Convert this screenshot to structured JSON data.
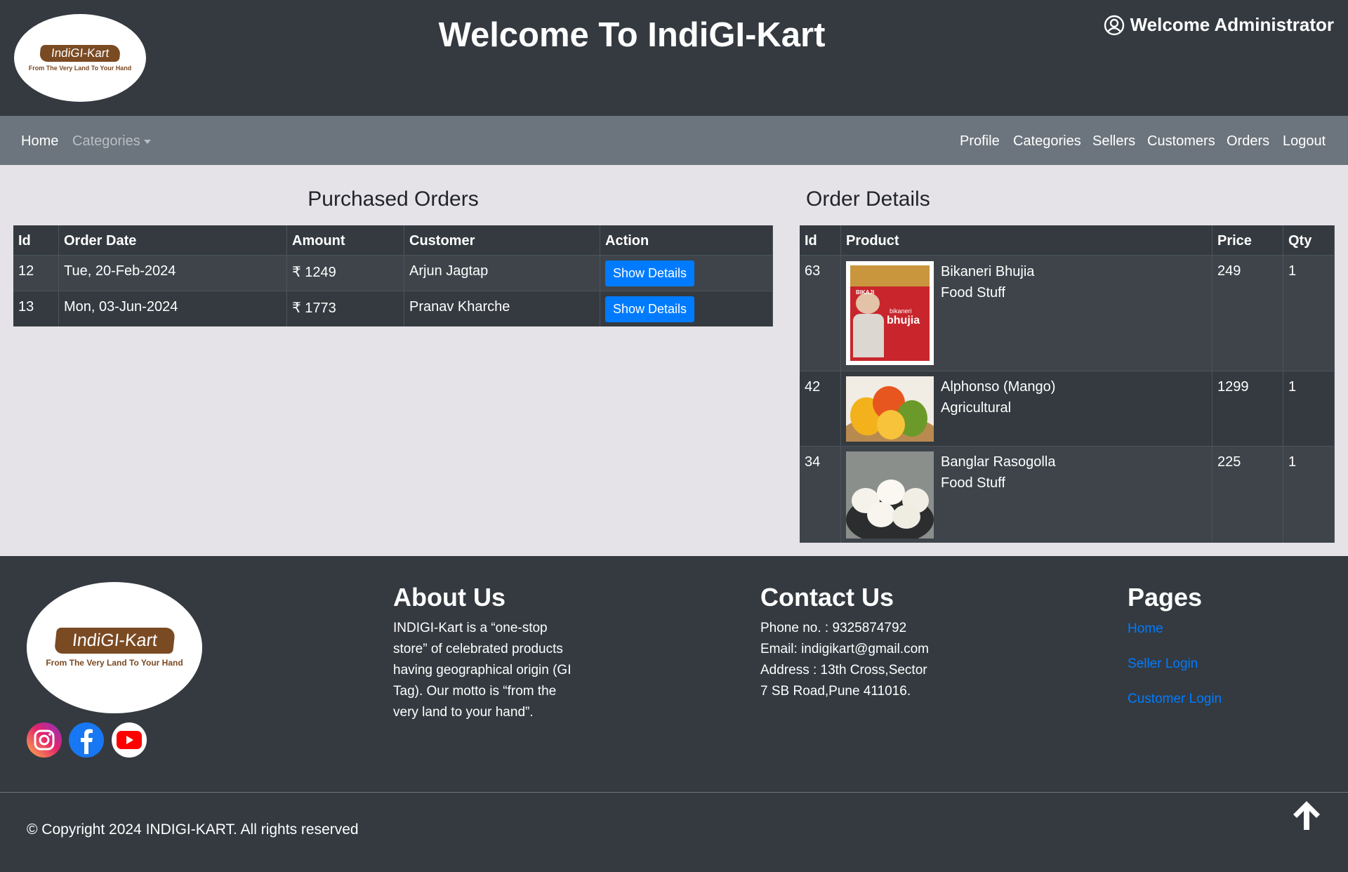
{
  "header": {
    "logo_text": "IndiGI-Kart",
    "logo_tagline": "From The Very Land To Your Hand",
    "title": "Welcome To IndiGI-Kart",
    "welcome": "Welcome Administrator"
  },
  "nav": {
    "left": {
      "home": "Home",
      "categories": "Categories"
    },
    "right": [
      "Profile",
      "Categories",
      "Sellers",
      "Customers",
      "Orders",
      "Logout"
    ]
  },
  "purchased_orders": {
    "title": "Purchased Orders",
    "columns": [
      "Id",
      "Order Date",
      "Amount",
      "Customer",
      "Action"
    ],
    "rows": [
      {
        "id": "12",
        "date": "Tue, 20-Feb-2024",
        "amount": "₹ 1249",
        "customer": "Arjun Jagtap",
        "action": "Show Details"
      },
      {
        "id": "13",
        "date": "Mon, 03-Jun-2024",
        "amount": "₹ 1773",
        "customer": "Pranav Kharche",
        "action": "Show Details"
      }
    ]
  },
  "order_details": {
    "title": "Order Details",
    "columns": [
      "Id",
      "Product",
      "Price",
      "Qty"
    ],
    "rows": [
      {
        "id": "63",
        "name": "Bikaneri Bhujia",
        "category": "Food Stuff",
        "price": "249",
        "qty": "1",
        "image_text_brand": "BIKAJI",
        "image_text_sub": "bikaneri",
        "image_text_main": "bhujia"
      },
      {
        "id": "42",
        "name": "Alphonso (Mango)",
        "category": "Agricultural",
        "price": "1299",
        "qty": "1"
      },
      {
        "id": "34",
        "name": "Banglar Rasogolla",
        "category": "Food Stuff",
        "price": "225",
        "qty": "1"
      }
    ]
  },
  "footer": {
    "logo_text": "IndiGI-Kart",
    "logo_tagline": "From The Very Land To Your Hand",
    "about": {
      "title": "About Us",
      "lines": [
        "INDIGI-Kart is a “one-stop",
        "store” of celebrated products",
        "having geographical origin (GI",
        "Tag). Our motto is “from the",
        "very land to your hand”."
      ]
    },
    "contact": {
      "title": "Contact Us",
      "lines": [
        "Phone no. : 9325874792",
        "Email: indigikart@gmail.com",
        "Address : 13th Cross,Sector",
        "7 SB Road,Pune 411016."
      ]
    },
    "pages": {
      "title": "Pages",
      "links": [
        "Home",
        "Seller Login",
        "Customer Login"
      ]
    },
    "copyright": "© Copyright 2024 INDIGI-KART. All rights reserved",
    "social_icons": [
      "instagram-icon",
      "facebook-icon",
      "youtube-icon"
    ]
  },
  "colors": {
    "header_bg": "#343a40",
    "nav_bg": "#6c757d",
    "page_bg": "#e6e3e8",
    "primary": "#007bff",
    "brand_brown": "#7a4a23"
  }
}
